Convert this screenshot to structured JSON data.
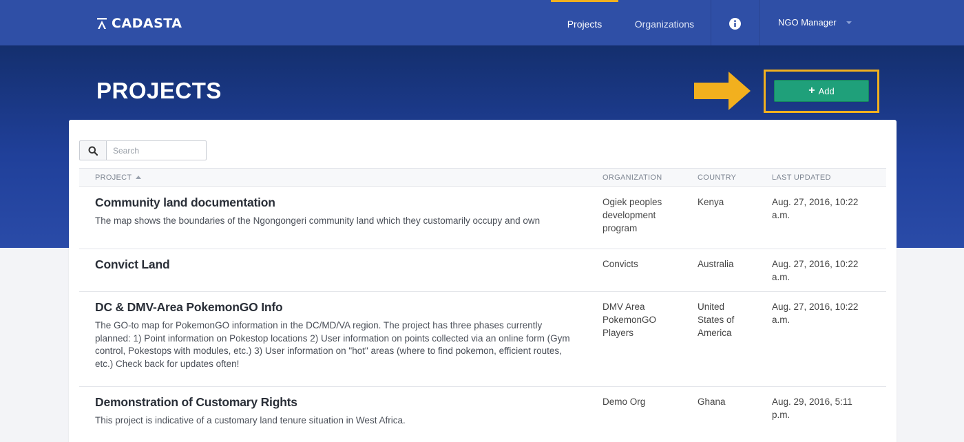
{
  "brand": {
    "name": "CADASTA"
  },
  "nav": {
    "items": [
      {
        "label": "Projects",
        "active": true
      },
      {
        "label": "Organizations",
        "active": false
      }
    ],
    "info_icon": "info-circle-icon",
    "user": {
      "label": "NGO Manager"
    }
  },
  "page": {
    "title": "PROJECTS",
    "add_button_label": "Add",
    "accent_color": "#f2b01e",
    "button_color": "#1fa07a"
  },
  "search": {
    "placeholder": "Search",
    "value": ""
  },
  "table": {
    "columns": [
      "PROJECT",
      "ORGANIZATION",
      "COUNTRY",
      "LAST UPDATED"
    ],
    "sort": {
      "column": "PROJECT",
      "direction": "ascending"
    },
    "rows": [
      {
        "name": "Community land documentation",
        "description": "The map shows the boundaries of the Ngongongeri community land which they customarily occupy and own",
        "organization": "Ogiek peoples development program",
        "country": "Kenya",
        "updated": "Aug. 27, 2016, 10:22 a.m."
      },
      {
        "name": "Convict Land",
        "description": "",
        "organization": "Convicts",
        "country": "Australia",
        "updated": "Aug. 27, 2016, 10:22 a.m."
      },
      {
        "name": "DC & DMV-Area PokemonGO Info",
        "description": "The GO-to map for PokemonGO information in the DC/MD/VA region. The project has three phases currently planned: 1) Point information on Pokestop locations 2) User information on points collected via an online form (Gym control, Pokestops with modules, etc.) 3) User information on \"hot\" areas (where to find pokemon, efficient routes, etc.) Check back for updates often!",
        "organization": "DMV Area PokemonGO Players",
        "country": "United States of America",
        "updated": "Aug. 27, 2016, 10:22 a.m."
      },
      {
        "name": "Demonstration of Customary Rights",
        "description": "This project is indicative of a customary land tenure situation in West Africa.",
        "organization": "Demo Org",
        "country": "Ghana",
        "updated": "Aug. 29, 2016, 5:11 p.m."
      }
    ]
  }
}
